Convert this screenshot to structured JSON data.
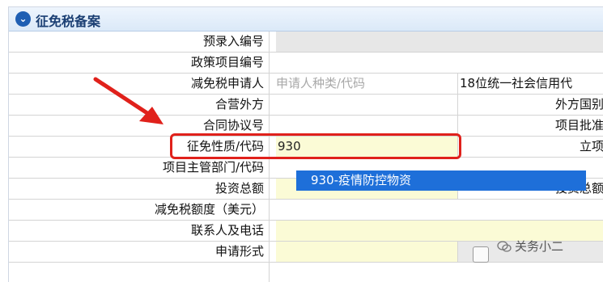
{
  "section": {
    "title": "征免税备案",
    "icon": "chevron-down-icon"
  },
  "rows": [
    {
      "label": "预录入编号"
    },
    {
      "label": "政策项目编号"
    },
    {
      "label": "减免税申请人",
      "placeholder1": "申请人种类/代码",
      "placeholder2": "18位统一社会信用代"
    },
    {
      "label": "合营外方",
      "right_label": "外方国别"
    },
    {
      "label": "合同协议号",
      "right_label": "项目批准"
    },
    {
      "label": "征免性质/代码",
      "value": "930",
      "right_label": "立项"
    },
    {
      "label": "项目主管部门/代码"
    },
    {
      "label": "投资总额",
      "right_label": "投资总额"
    },
    {
      "label": "减免税额度（美元）"
    },
    {
      "label": "联系人及电话"
    },
    {
      "label": "申请形式"
    }
  ],
  "dropdown_option": "930-疫情防控物资",
  "watermark": "关务小二",
  "colors": {
    "highlight_box": "#e0211b",
    "dropdown_bg": "#1e6fd9",
    "arrow": "#e0211b"
  }
}
